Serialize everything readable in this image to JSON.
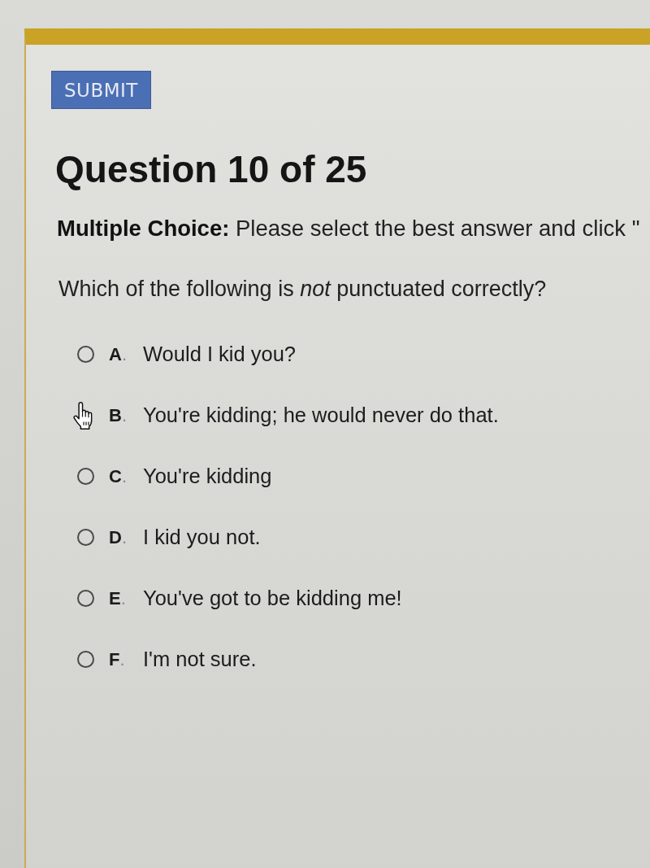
{
  "submit_button": {
    "label": "SUBMIT"
  },
  "question_title": "Question 10 of 25",
  "instructions": "**Multiple Choice:** Please select the best answer and click \"",
  "question": "Which of the following is *not* punctuated correctly?",
  "options": [
    {
      "letter": "**A**.",
      "text": "Would I kid you?",
      "selected": false,
      "hovered": false
    },
    {
      "letter": "**B**.",
      "text": "You're kidding; he would never do that.",
      "selected": false,
      "hovered": true
    },
    {
      "letter": "**C**.",
      "text": "You're kidding",
      "selected": false,
      "hovered": false
    },
    {
      "letter": "**D**.",
      "text": "I kid you not.",
      "selected": false,
      "hovered": false
    },
    {
      "letter": "**E**.",
      "text": "You've got to be kidding me!",
      "selected": false,
      "hovered": false
    },
    {
      "letter": "**F**.",
      "text": "I'm not sure.",
      "selected": false,
      "hovered": false
    }
  ]
}
